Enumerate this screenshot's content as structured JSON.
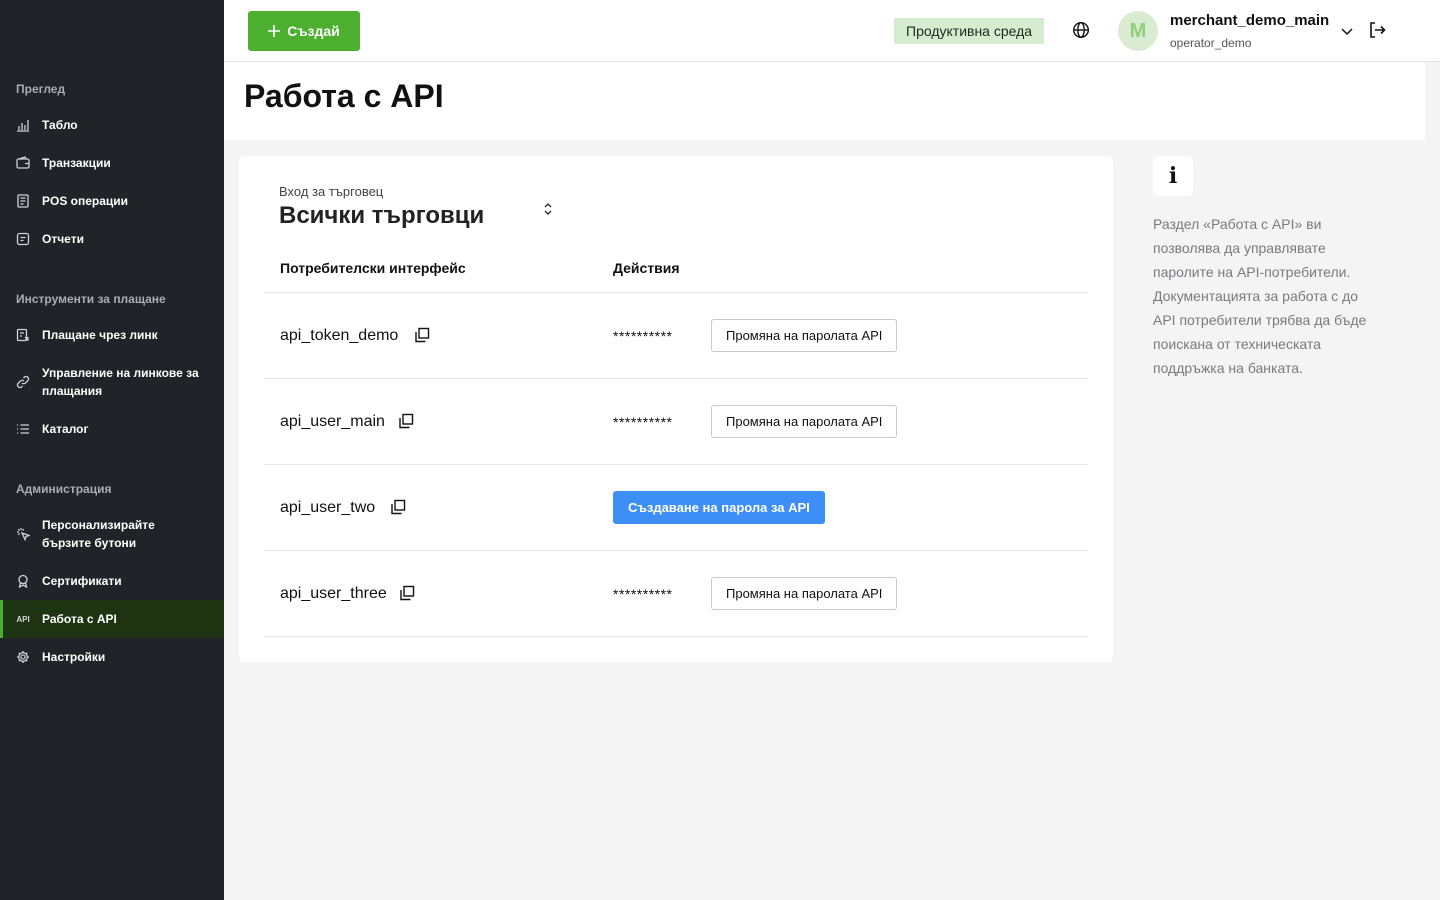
{
  "header": {
    "create_label": "Създай",
    "environment": "Продуктивна среда",
    "avatar_letter": "M",
    "user_name": "merchant_demo_main",
    "user_sub": "operator_demo"
  },
  "sidebar": {
    "sections": [
      {
        "title": "Преглед"
      },
      {
        "title": "Инструменти за плащане"
      },
      {
        "title": "Администрация"
      }
    ],
    "items": [
      {
        "label": "Табло",
        "icon": "chart-bars-icon"
      },
      {
        "label": "Транзакции",
        "icon": "wallet-icon"
      },
      {
        "label": "POS операции",
        "icon": "receipt-icon"
      },
      {
        "label": "Отчети",
        "icon": "document-icon"
      },
      {
        "label": "Плащане чрез линк",
        "icon": "link-payment-icon"
      },
      {
        "label": "Управление на линкове за плащания",
        "icon": "link-icon"
      },
      {
        "label": "Каталог",
        "icon": "list-icon"
      },
      {
        "label": "Персонализирайте бързите бутони",
        "icon": "sparkle-click-icon"
      },
      {
        "label": "Сертификати",
        "icon": "certificate-icon"
      },
      {
        "label": "Работа с API",
        "icon": "api-icon",
        "icon_text": "API",
        "active": true
      },
      {
        "label": "Настройки",
        "icon": "gear-icon"
      }
    ]
  },
  "page": {
    "title": "Работа с API"
  },
  "merchant_selector": {
    "label": "Вход за търговец",
    "value": "Всички търговци"
  },
  "table": {
    "columns": [
      "Потребителски интерфейс",
      "Действия"
    ],
    "rows": [
      {
        "username": "api_token_demo",
        "password_mask": "**********",
        "action": "Промяна на паролата API"
      },
      {
        "username": "api_user_main",
        "password_mask": "**********",
        "action": "Промяна на паролата API"
      },
      {
        "username": "api_user_two",
        "password_mask": "",
        "action": "Създаване на парола за API"
      },
      {
        "username": "api_user_three",
        "password_mask": "**********",
        "action": "Промяна на паролата API"
      }
    ]
  },
  "info": {
    "icon": "info-icon",
    "glyph": "i",
    "text": "Раздел «Работа с API» ви позволява да управлявате паролите на API-потребители. Документацията за работа с до API потребители трябва да бъде поискана от техническата поддръжка на банката."
  },
  "colors": {
    "sidebar_bg": "#202327",
    "accent_green": "#4caf2f",
    "active_item_bg": "#1e3312",
    "primary_blue": "#3d8ef7",
    "env_badge_bg": "#d6ecd1"
  }
}
